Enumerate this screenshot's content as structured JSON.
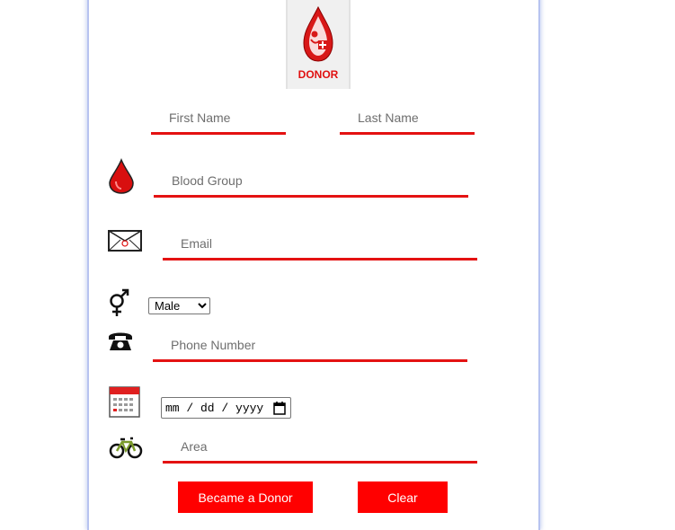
{
  "logo": {
    "text": "DONOR",
    "icon": "blood-drop-donor-logo"
  },
  "form": {
    "first_name": {
      "placeholder": "First Name",
      "value": ""
    },
    "last_name": {
      "placeholder": "Last Name",
      "value": ""
    },
    "blood_group": {
      "placeholder": "Blood Group",
      "value": "",
      "icon": "blood-drop-icon"
    },
    "email": {
      "placeholder": "Email",
      "value": "",
      "icon": "envelope-icon"
    },
    "gender": {
      "selected": "Male",
      "icon": "gender-icon"
    },
    "phone": {
      "placeholder": "Phone Number",
      "value": "",
      "icon": "telephone-icon"
    },
    "dob": {
      "display": "mm / dd / yyyy",
      "icon": "calendar-icon"
    },
    "area": {
      "placeholder": "Area",
      "value": "",
      "icon": "bicycle-icon"
    }
  },
  "buttons": {
    "submit": "Became a Donor",
    "clear": "Clear"
  },
  "colors": {
    "accent": "#ff0000",
    "underline": "#e41212",
    "frame": "#b7c3f0"
  }
}
